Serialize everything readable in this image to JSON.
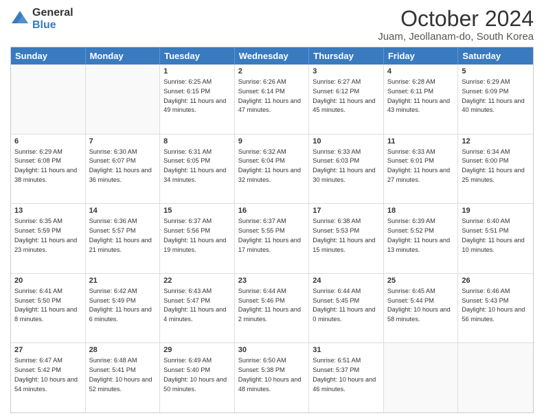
{
  "logo": {
    "line1": "General",
    "line2": "Blue"
  },
  "title": "October 2024",
  "location": "Juam, Jeollanam-do, South Korea",
  "header_days": [
    "Sunday",
    "Monday",
    "Tuesday",
    "Wednesday",
    "Thursday",
    "Friday",
    "Saturday"
  ],
  "rows": [
    [
      {
        "day": "",
        "text": "",
        "empty": true
      },
      {
        "day": "",
        "text": "",
        "empty": true
      },
      {
        "day": "1",
        "text": "Sunrise: 6:25 AM\nSunset: 6:15 PM\nDaylight: 11 hours and 49 minutes."
      },
      {
        "day": "2",
        "text": "Sunrise: 6:26 AM\nSunset: 6:14 PM\nDaylight: 11 hours and 47 minutes."
      },
      {
        "day": "3",
        "text": "Sunrise: 6:27 AM\nSunset: 6:12 PM\nDaylight: 11 hours and 45 minutes."
      },
      {
        "day": "4",
        "text": "Sunrise: 6:28 AM\nSunset: 6:11 PM\nDaylight: 11 hours and 43 minutes."
      },
      {
        "day": "5",
        "text": "Sunrise: 6:29 AM\nSunset: 6:09 PM\nDaylight: 11 hours and 40 minutes."
      }
    ],
    [
      {
        "day": "6",
        "text": "Sunrise: 6:29 AM\nSunset: 6:08 PM\nDaylight: 11 hours and 38 minutes."
      },
      {
        "day": "7",
        "text": "Sunrise: 6:30 AM\nSunset: 6:07 PM\nDaylight: 11 hours and 36 minutes."
      },
      {
        "day": "8",
        "text": "Sunrise: 6:31 AM\nSunset: 6:05 PM\nDaylight: 11 hours and 34 minutes."
      },
      {
        "day": "9",
        "text": "Sunrise: 6:32 AM\nSunset: 6:04 PM\nDaylight: 11 hours and 32 minutes."
      },
      {
        "day": "10",
        "text": "Sunrise: 6:33 AM\nSunset: 6:03 PM\nDaylight: 11 hours and 30 minutes."
      },
      {
        "day": "11",
        "text": "Sunrise: 6:33 AM\nSunset: 6:01 PM\nDaylight: 11 hours and 27 minutes."
      },
      {
        "day": "12",
        "text": "Sunrise: 6:34 AM\nSunset: 6:00 PM\nDaylight: 11 hours and 25 minutes."
      }
    ],
    [
      {
        "day": "13",
        "text": "Sunrise: 6:35 AM\nSunset: 5:59 PM\nDaylight: 11 hours and 23 minutes."
      },
      {
        "day": "14",
        "text": "Sunrise: 6:36 AM\nSunset: 5:57 PM\nDaylight: 11 hours and 21 minutes."
      },
      {
        "day": "15",
        "text": "Sunrise: 6:37 AM\nSunset: 5:56 PM\nDaylight: 11 hours and 19 minutes."
      },
      {
        "day": "16",
        "text": "Sunrise: 6:37 AM\nSunset: 5:55 PM\nDaylight: 11 hours and 17 minutes."
      },
      {
        "day": "17",
        "text": "Sunrise: 6:38 AM\nSunset: 5:53 PM\nDaylight: 11 hours and 15 minutes."
      },
      {
        "day": "18",
        "text": "Sunrise: 6:39 AM\nSunset: 5:52 PM\nDaylight: 11 hours and 13 minutes."
      },
      {
        "day": "19",
        "text": "Sunrise: 6:40 AM\nSunset: 5:51 PM\nDaylight: 11 hours and 10 minutes."
      }
    ],
    [
      {
        "day": "20",
        "text": "Sunrise: 6:41 AM\nSunset: 5:50 PM\nDaylight: 11 hours and 8 minutes."
      },
      {
        "day": "21",
        "text": "Sunrise: 6:42 AM\nSunset: 5:49 PM\nDaylight: 11 hours and 6 minutes."
      },
      {
        "day": "22",
        "text": "Sunrise: 6:43 AM\nSunset: 5:47 PM\nDaylight: 11 hours and 4 minutes."
      },
      {
        "day": "23",
        "text": "Sunrise: 6:44 AM\nSunset: 5:46 PM\nDaylight: 11 hours and 2 minutes."
      },
      {
        "day": "24",
        "text": "Sunrise: 6:44 AM\nSunset: 5:45 PM\nDaylight: 11 hours and 0 minutes."
      },
      {
        "day": "25",
        "text": "Sunrise: 6:45 AM\nSunset: 5:44 PM\nDaylight: 10 hours and 58 minutes."
      },
      {
        "day": "26",
        "text": "Sunrise: 6:46 AM\nSunset: 5:43 PM\nDaylight: 10 hours and 56 minutes."
      }
    ],
    [
      {
        "day": "27",
        "text": "Sunrise: 6:47 AM\nSunset: 5:42 PM\nDaylight: 10 hours and 54 minutes."
      },
      {
        "day": "28",
        "text": "Sunrise: 6:48 AM\nSunset: 5:41 PM\nDaylight: 10 hours and 52 minutes."
      },
      {
        "day": "29",
        "text": "Sunrise: 6:49 AM\nSunset: 5:40 PM\nDaylight: 10 hours and 50 minutes."
      },
      {
        "day": "30",
        "text": "Sunrise: 6:50 AM\nSunset: 5:38 PM\nDaylight: 10 hours and 48 minutes."
      },
      {
        "day": "31",
        "text": "Sunrise: 6:51 AM\nSunset: 5:37 PM\nDaylight: 10 hours and 46 minutes."
      },
      {
        "day": "",
        "text": "",
        "empty": true
      },
      {
        "day": "",
        "text": "",
        "empty": true
      }
    ]
  ]
}
